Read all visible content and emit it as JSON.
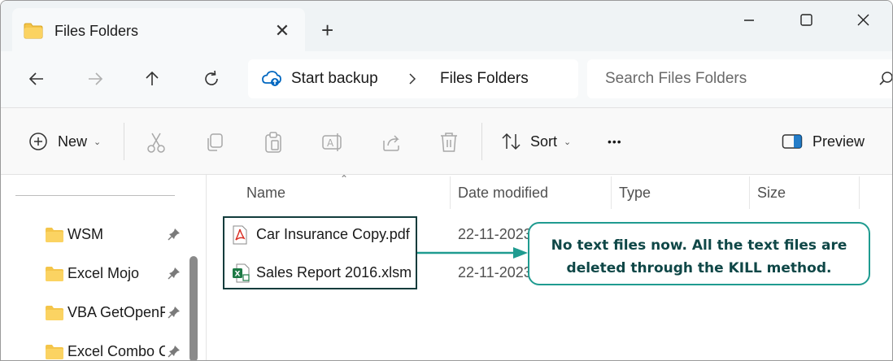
{
  "window": {
    "tab_title": "Files Folders",
    "tab_close_glyph": "✕",
    "new_tab_glyph": "+"
  },
  "address": {
    "crumbs": [
      "Start backup",
      "Files Folders"
    ],
    "search_placeholder": "Search Files Folders"
  },
  "commands": {
    "new_label": "New",
    "sort_label": "Sort",
    "more_glyph": "•••",
    "preview_label": "Preview"
  },
  "nav_pane": {
    "items": [
      {
        "label": "WSM",
        "icon": "folder-icon",
        "pinned": true
      },
      {
        "label": "Excel Mojo",
        "icon": "folder-icon",
        "pinned": true
      },
      {
        "label": "VBA GetOpenF",
        "icon": "folder-icon",
        "pinned": true
      },
      {
        "label": "Excel Combo C",
        "icon": "folder-icon",
        "pinned": true
      }
    ]
  },
  "file_list": {
    "columns": [
      "Name",
      "Date modified",
      "Type",
      "Size"
    ],
    "files": [
      {
        "name": "Car Insurance Copy.pdf",
        "icon": "pdf-icon",
        "date": "22-11-2023"
      },
      {
        "name": "Sales Report 2016.xlsm",
        "icon": "excel-icon",
        "date": "22-11-2023"
      }
    ]
  },
  "annotation": {
    "lines": [
      "No text files now. All the text files are",
      "deleted through the KILL method."
    ]
  },
  "colors": {
    "callout_border": "#1f9b90",
    "callout_text": "#0f4747",
    "arrow": "#1f9b90",
    "highlight_border": "#123c3c",
    "folder": "#f4c54a",
    "pdf": "#d93025",
    "excel": "#1d7a45",
    "accent_blue": "#0067c0"
  }
}
